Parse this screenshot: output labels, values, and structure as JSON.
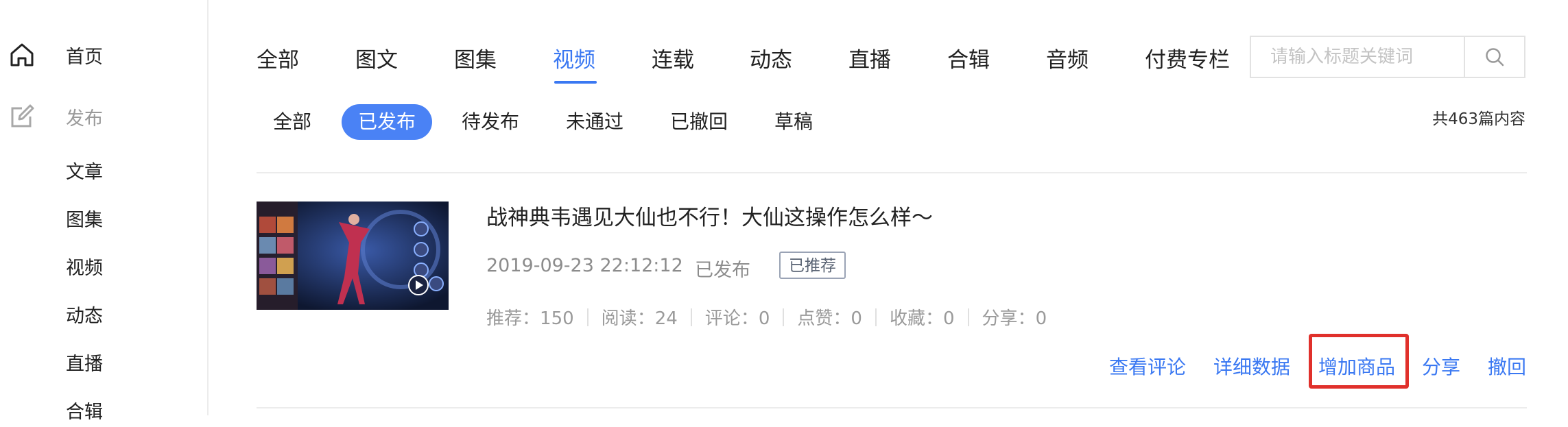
{
  "sidebar": {
    "home": "首页",
    "publish": "发布",
    "items": [
      "文章",
      "图集",
      "视频",
      "动态",
      "直播",
      "合辑"
    ]
  },
  "tabs": [
    {
      "label": "全部",
      "active": false
    },
    {
      "label": "图文",
      "active": false
    },
    {
      "label": "图集",
      "active": false
    },
    {
      "label": "视频",
      "active": true
    },
    {
      "label": "连载",
      "active": false
    },
    {
      "label": "动态",
      "active": false
    },
    {
      "label": "直播",
      "active": false
    },
    {
      "label": "合辑",
      "active": false
    },
    {
      "label": "音频",
      "active": false
    },
    {
      "label": "付费专栏",
      "active": false
    }
  ],
  "search": {
    "placeholder": "请输入标题关键词",
    "value": ""
  },
  "subtabs": [
    {
      "label": "全部",
      "active": false
    },
    {
      "label": "已发布",
      "active": true
    },
    {
      "label": "待发布",
      "active": false
    },
    {
      "label": "未通过",
      "active": false
    },
    {
      "label": "已撤回",
      "active": false
    },
    {
      "label": "草稿",
      "active": false
    }
  ],
  "count_text": "共463篇内容",
  "article": {
    "title": "战神典韦遇见大仙也不行！大仙这操作怎么样～",
    "date": "2019-09-23 22:12:12",
    "status": "已发布",
    "badge": "已推荐",
    "stats": [
      {
        "label": "推荐",
        "value": "150"
      },
      {
        "label": "阅读",
        "value": "24"
      },
      {
        "label": "评论",
        "value": "0"
      },
      {
        "label": "点赞",
        "value": "0"
      },
      {
        "label": "收藏",
        "value": "0"
      },
      {
        "label": "分享",
        "value": "0"
      }
    ],
    "actions": [
      "查看评论",
      "详细数据",
      "增加商品",
      "分享",
      "撤回"
    ],
    "highlighted_action": "增加商品"
  },
  "colors": {
    "accent": "#3a78f2",
    "highlight": "#e0302b"
  }
}
